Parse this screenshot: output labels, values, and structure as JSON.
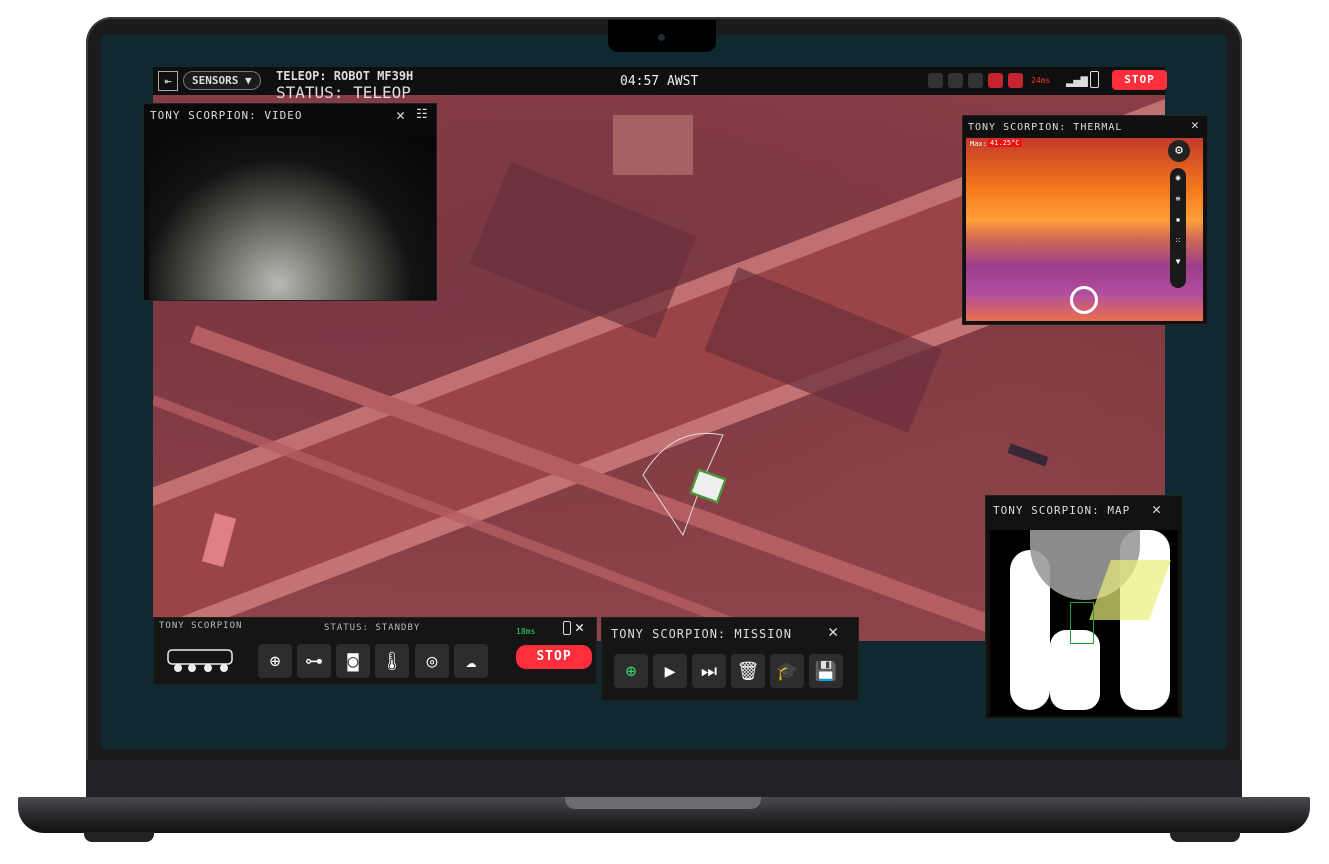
{
  "topbar": {
    "sensors_label": "SENSORS ▼",
    "teleop": "TELEOP: ROBOT MF39H",
    "status": "STATUS: TELEOP",
    "time": "04:57 AWST",
    "latency": "24ms",
    "stop": "STOP"
  },
  "video": {
    "title": "TONY SCORPION: VIDEO"
  },
  "thermal": {
    "title": "TONY SCORPION: THERMAL",
    "max_label": "Max:",
    "max_value": "41.25°C"
  },
  "map": {
    "title": "TONY SCORPION: MAP"
  },
  "robot": {
    "name": "TONY SCORPION",
    "status": "STATUS: STANDBY",
    "latency": "18ms",
    "stop": "STOP"
  },
  "mission": {
    "title": "TONY SCORPION: MISSION"
  },
  "colors": {
    "accent_red": "#ff2e3a",
    "latency_green": "#35d36b",
    "screen_bg": "#0e2a30"
  }
}
